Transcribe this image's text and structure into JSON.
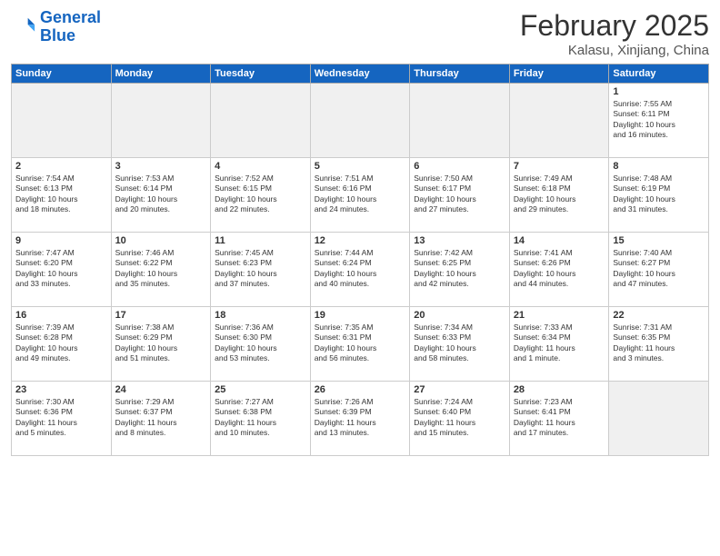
{
  "logo": {
    "line1": "General",
    "line2": "Blue"
  },
  "title": "February 2025",
  "subtitle": "Kalasu, Xinjiang, China",
  "weekdays": [
    "Sunday",
    "Monday",
    "Tuesday",
    "Wednesday",
    "Thursday",
    "Friday",
    "Saturday"
  ],
  "weeks": [
    [
      {
        "day": "",
        "info": ""
      },
      {
        "day": "",
        "info": ""
      },
      {
        "day": "",
        "info": ""
      },
      {
        "day": "",
        "info": ""
      },
      {
        "day": "",
        "info": ""
      },
      {
        "day": "",
        "info": ""
      },
      {
        "day": "1",
        "info": "Sunrise: 7:55 AM\nSunset: 6:11 PM\nDaylight: 10 hours\nand 16 minutes."
      }
    ],
    [
      {
        "day": "2",
        "info": "Sunrise: 7:54 AM\nSunset: 6:13 PM\nDaylight: 10 hours\nand 18 minutes."
      },
      {
        "day": "3",
        "info": "Sunrise: 7:53 AM\nSunset: 6:14 PM\nDaylight: 10 hours\nand 20 minutes."
      },
      {
        "day": "4",
        "info": "Sunrise: 7:52 AM\nSunset: 6:15 PM\nDaylight: 10 hours\nand 22 minutes."
      },
      {
        "day": "5",
        "info": "Sunrise: 7:51 AM\nSunset: 6:16 PM\nDaylight: 10 hours\nand 24 minutes."
      },
      {
        "day": "6",
        "info": "Sunrise: 7:50 AM\nSunset: 6:17 PM\nDaylight: 10 hours\nand 27 minutes."
      },
      {
        "day": "7",
        "info": "Sunrise: 7:49 AM\nSunset: 6:18 PM\nDaylight: 10 hours\nand 29 minutes."
      },
      {
        "day": "8",
        "info": "Sunrise: 7:48 AM\nSunset: 6:19 PM\nDaylight: 10 hours\nand 31 minutes."
      }
    ],
    [
      {
        "day": "9",
        "info": "Sunrise: 7:47 AM\nSunset: 6:20 PM\nDaylight: 10 hours\nand 33 minutes."
      },
      {
        "day": "10",
        "info": "Sunrise: 7:46 AM\nSunset: 6:22 PM\nDaylight: 10 hours\nand 35 minutes."
      },
      {
        "day": "11",
        "info": "Sunrise: 7:45 AM\nSunset: 6:23 PM\nDaylight: 10 hours\nand 37 minutes."
      },
      {
        "day": "12",
        "info": "Sunrise: 7:44 AM\nSunset: 6:24 PM\nDaylight: 10 hours\nand 40 minutes."
      },
      {
        "day": "13",
        "info": "Sunrise: 7:42 AM\nSunset: 6:25 PM\nDaylight: 10 hours\nand 42 minutes."
      },
      {
        "day": "14",
        "info": "Sunrise: 7:41 AM\nSunset: 6:26 PM\nDaylight: 10 hours\nand 44 minutes."
      },
      {
        "day": "15",
        "info": "Sunrise: 7:40 AM\nSunset: 6:27 PM\nDaylight: 10 hours\nand 47 minutes."
      }
    ],
    [
      {
        "day": "16",
        "info": "Sunrise: 7:39 AM\nSunset: 6:28 PM\nDaylight: 10 hours\nand 49 minutes."
      },
      {
        "day": "17",
        "info": "Sunrise: 7:38 AM\nSunset: 6:29 PM\nDaylight: 10 hours\nand 51 minutes."
      },
      {
        "day": "18",
        "info": "Sunrise: 7:36 AM\nSunset: 6:30 PM\nDaylight: 10 hours\nand 53 minutes."
      },
      {
        "day": "19",
        "info": "Sunrise: 7:35 AM\nSunset: 6:31 PM\nDaylight: 10 hours\nand 56 minutes."
      },
      {
        "day": "20",
        "info": "Sunrise: 7:34 AM\nSunset: 6:33 PM\nDaylight: 10 hours\nand 58 minutes."
      },
      {
        "day": "21",
        "info": "Sunrise: 7:33 AM\nSunset: 6:34 PM\nDaylight: 11 hours\nand 1 minute."
      },
      {
        "day": "22",
        "info": "Sunrise: 7:31 AM\nSunset: 6:35 PM\nDaylight: 11 hours\nand 3 minutes."
      }
    ],
    [
      {
        "day": "23",
        "info": "Sunrise: 7:30 AM\nSunset: 6:36 PM\nDaylight: 11 hours\nand 5 minutes."
      },
      {
        "day": "24",
        "info": "Sunrise: 7:29 AM\nSunset: 6:37 PM\nDaylight: 11 hours\nand 8 minutes."
      },
      {
        "day": "25",
        "info": "Sunrise: 7:27 AM\nSunset: 6:38 PM\nDaylight: 11 hours\nand 10 minutes."
      },
      {
        "day": "26",
        "info": "Sunrise: 7:26 AM\nSunset: 6:39 PM\nDaylight: 11 hours\nand 13 minutes."
      },
      {
        "day": "27",
        "info": "Sunrise: 7:24 AM\nSunset: 6:40 PM\nDaylight: 11 hours\nand 15 minutes."
      },
      {
        "day": "28",
        "info": "Sunrise: 7:23 AM\nSunset: 6:41 PM\nDaylight: 11 hours\nand 17 minutes."
      },
      {
        "day": "",
        "info": ""
      }
    ]
  ]
}
